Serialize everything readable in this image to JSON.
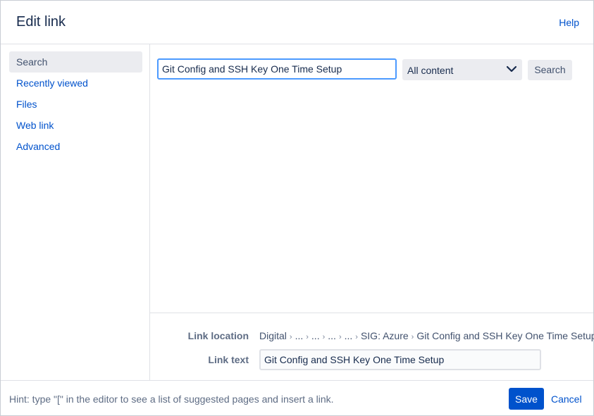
{
  "dialog": {
    "title": "Edit link",
    "help_label": "Help"
  },
  "sidebar": {
    "items": [
      {
        "label": "Search",
        "active": true
      },
      {
        "label": "Recently viewed"
      },
      {
        "label": "Files"
      },
      {
        "label": "Web link"
      },
      {
        "label": "Advanced"
      }
    ]
  },
  "search": {
    "value": "Git Config and SSH Key One Time Setup",
    "scope_selected": "All content",
    "button_label": "Search"
  },
  "location": {
    "label": "Link location",
    "crumbs": [
      "Digital",
      "...",
      "...",
      "...",
      "...",
      "SIG: Azure",
      "Git Config and SSH Key One Time Setup"
    ]
  },
  "link_text": {
    "label": "Link text",
    "value": "Git Config and SSH Key One Time Setup"
  },
  "footer": {
    "hint": "Hint: type \"[\" in the editor to see a list of suggested pages and insert a link.",
    "save_label": "Save",
    "cancel_label": "Cancel"
  },
  "colors": {
    "primary": "#0052cc",
    "focus_border": "#4c9aff",
    "neutral_bg": "#ebecf0"
  }
}
